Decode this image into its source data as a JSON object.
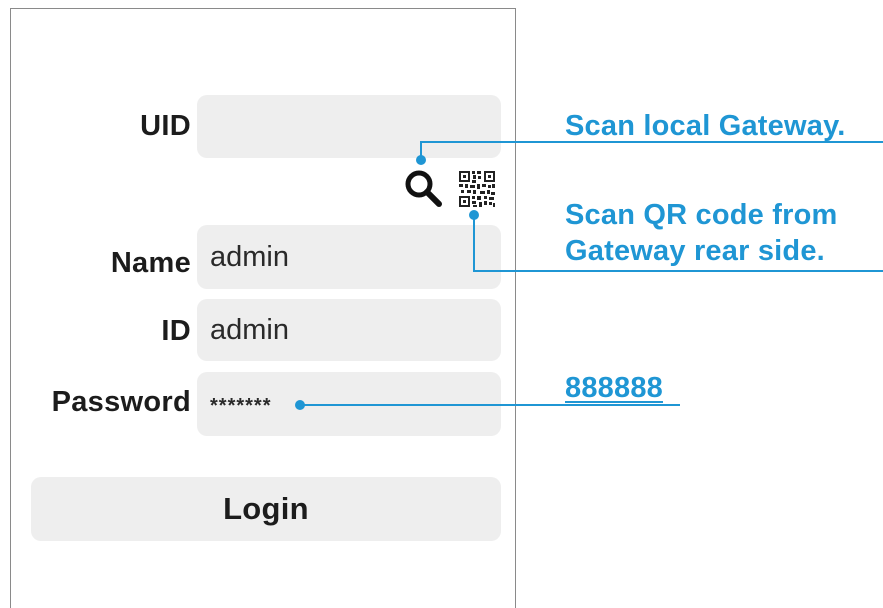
{
  "form": {
    "uid_label": "UID",
    "uid_value": "",
    "name_label": "Name",
    "name_value": "admin",
    "id_label": "ID",
    "id_value": "admin",
    "password_label": "Password",
    "password_value": "*******",
    "login_label": "Login"
  },
  "icons": {
    "search": "search-icon",
    "qr": "qr-code-icon"
  },
  "callouts": {
    "scan_local": "Scan local Gateway.",
    "scan_qr_line1": "Scan QR code from",
    "scan_qr_line2": "Gateway rear side.",
    "default_password": "888888"
  },
  "colors": {
    "callout": "#1f96d4",
    "field_bg": "#eeeeee",
    "frame": "#8a8a8a"
  }
}
